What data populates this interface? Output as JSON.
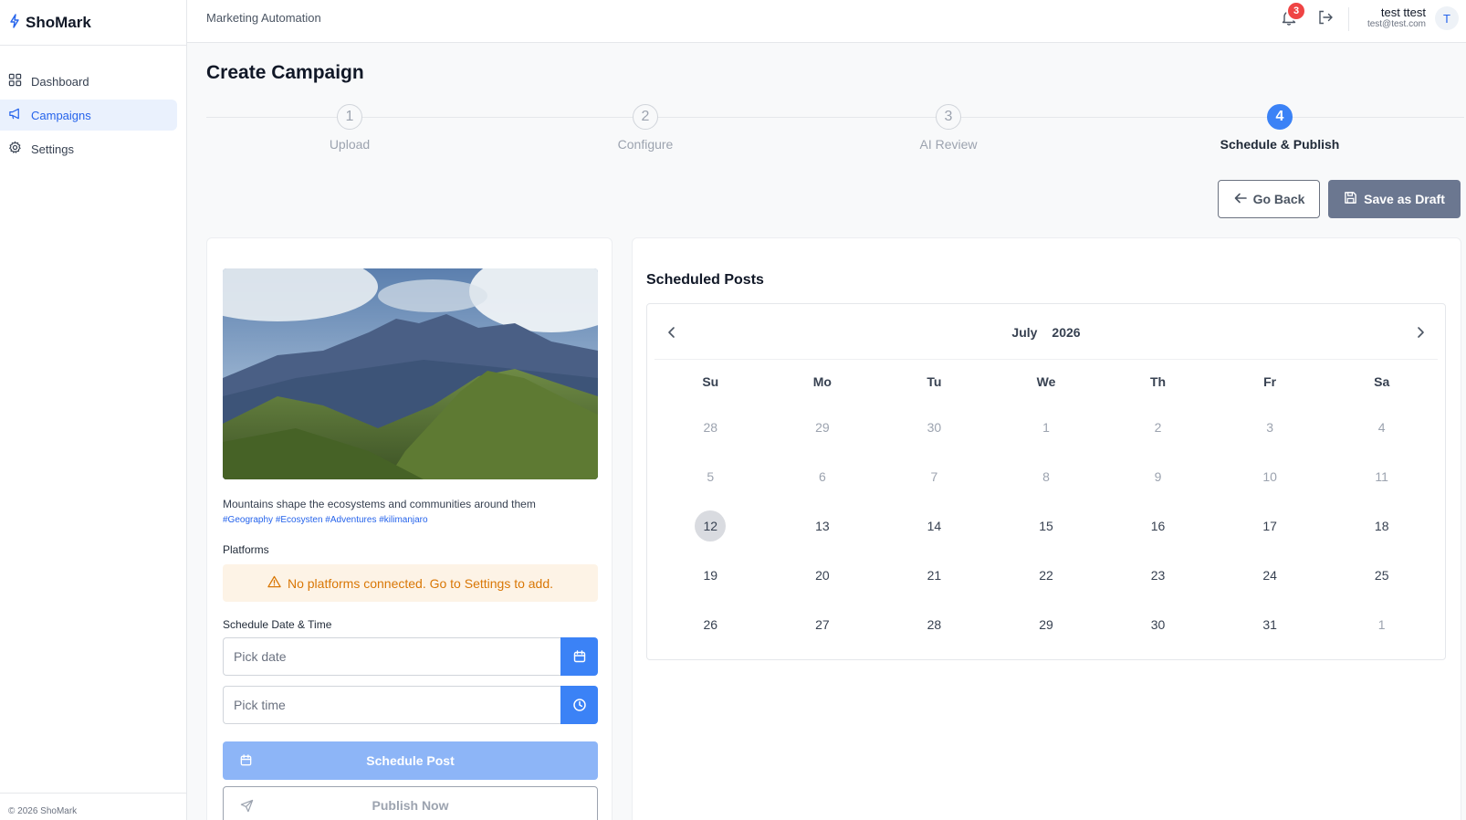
{
  "brand": {
    "name": "ShoMark",
    "footer": "© 2026 ShoMark"
  },
  "nav": [
    {
      "label": "Dashboard",
      "icon": "grid-icon",
      "active": false
    },
    {
      "label": "Campaigns",
      "icon": "megaphone-icon",
      "active": true
    },
    {
      "label": "Settings",
      "icon": "gear-icon",
      "active": false
    }
  ],
  "header": {
    "breadcrumb": "Marketing Automation",
    "notification_count": "3",
    "user_name": "test ttest",
    "user_email": "test@test.com",
    "avatar_initial": "T"
  },
  "page": {
    "title": "Create Campaign"
  },
  "steps": [
    {
      "number": "1",
      "label": "Upload",
      "active": false
    },
    {
      "number": "2",
      "label": "Configure",
      "active": false
    },
    {
      "number": "3",
      "label": "AI Review",
      "active": false
    },
    {
      "number": "4",
      "label": "Schedule & Publish",
      "active": true
    }
  ],
  "actions": {
    "back_label": "Go Back",
    "draft_label": "Save as Draft"
  },
  "post": {
    "caption": "Mountains shape the ecosystems and communities around them",
    "hashtags": "#Geography #Ecosysten #Adventures #kilimanjaro",
    "platforms_label": "Platforms",
    "alert": "No platforms connected. Go to Settings to add.",
    "schedule_label": "Schedule Date & Time",
    "date_placeholder": "Pick date",
    "time_placeholder": "Pick time",
    "schedule_button": "Schedule Post",
    "publish_button": "Publish Now"
  },
  "scheduled": {
    "title": "Scheduled Posts",
    "month": "July",
    "year": "2026",
    "weekdays": [
      "Su",
      "Mo",
      "Tu",
      "We",
      "Th",
      "Fr",
      "Sa"
    ],
    "days": [
      [
        "28",
        "29",
        "30",
        "1",
        "2",
        "3",
        "4"
      ],
      [
        "5",
        "6",
        "7",
        "8",
        "9",
        "10",
        "11"
      ],
      [
        "12",
        "13",
        "14",
        "15",
        "16",
        "17",
        "18"
      ],
      [
        "19",
        "20",
        "21",
        "22",
        "23",
        "24",
        "25"
      ],
      [
        "26",
        "27",
        "28",
        "29",
        "30",
        "31",
        "1"
      ]
    ],
    "today": "12"
  },
  "colors": {
    "accent": "#3b82f6",
    "badge": "#ef4444",
    "warning": "#d97706"
  }
}
